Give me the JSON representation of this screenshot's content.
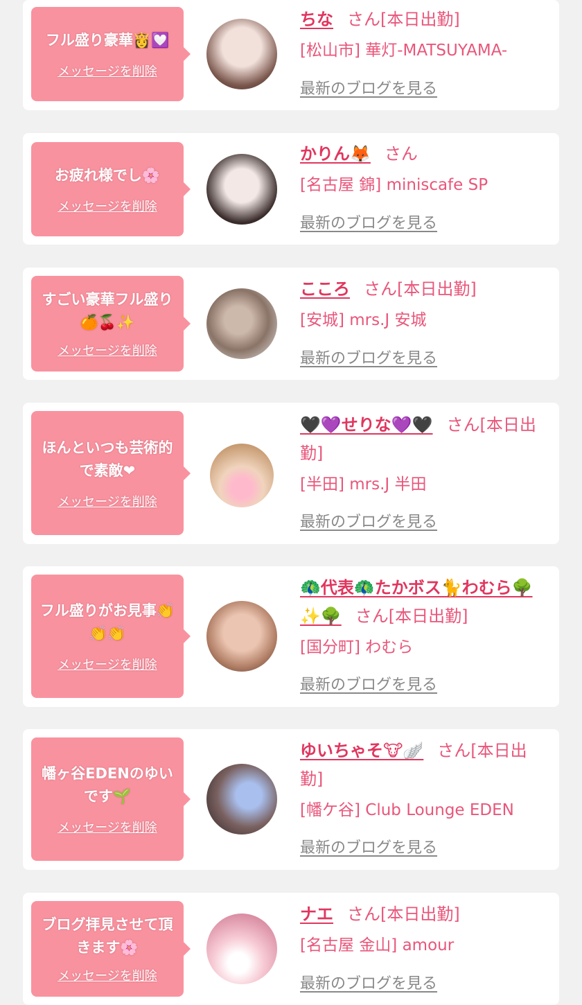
{
  "cards": [
    {
      "message": "フル盛り豪華👸💟",
      "delete_label": "メッセージを削除",
      "name": "ちな",
      "suffix": "さん[本日出勤]",
      "shop": "[松山市] 華灯-MATSUYAMA-",
      "blog_label": "最新のブログを見る",
      "avatar_colors": [
        "#e9d8d2",
        "#6a4a43"
      ]
    },
    {
      "message": "お疲れ様でし🌸",
      "delete_label": "メッセージを削除",
      "name": "かりん🦊",
      "suffix": "さん",
      "shop": "[名古屋 錦] miniscafe SP",
      "blog_label": "最新のブログを見る",
      "avatar_colors": [
        "#efe6e6",
        "#2b2323"
      ]
    },
    {
      "message": "すごい豪華フル盛り🍊🍒✨",
      "delete_label": "メッセージを削除",
      "name": "こころ",
      "suffix": "さん[本日出勤]",
      "shop": "[安城] mrs.J 安城",
      "blog_label": "最新のブログを見る",
      "avatar_colors": [
        "#c9b5a7",
        "#6e5b50"
      ]
    },
    {
      "message": "ほんといつも芸術的で素敵❤",
      "delete_label": "メッセージを削除",
      "name": "🖤💜せりな💜🖤",
      "suffix": "さん[本日出勤]",
      "shop": "[半田] mrs.J 半田",
      "blog_label": "最新のブログを見る",
      "avatar_colors": [
        "#f3d9c2",
        "#ffb3c6"
      ]
    },
    {
      "message": "フル盛りがお見事👏👏👏",
      "delete_label": "メッセージを削除",
      "name": "🦚代表🦚たかボス🐈わむら🌳✨🌳",
      "suffix": "さん[本日出勤]",
      "shop": "[国分町] わむら",
      "blog_label": "最新のブログを見る",
      "avatar_colors": [
        "#e3b7a0",
        "#5c3a30"
      ]
    },
    {
      "message": "幡ヶ谷EDENのゆいです🌱",
      "delete_label": "メッセージを削除",
      "name": "ゆいちゃそ🐮🪽",
      "suffix": "さん[本日出勤]",
      "shop": "[幡ケ谷] Club Lounge EDEN",
      "blog_label": "最新のブログを見る",
      "avatar_colors": [
        "#5b4a4a",
        "#9fb7ea"
      ]
    },
    {
      "message": "ブログ拝見させて頂きます🌸",
      "delete_label": "メッセージを削除",
      "name": "ナエ",
      "suffix": "さん[本日出勤]",
      "shop": "[名古屋 金山] amour",
      "blog_label": "最新のブログを見る",
      "avatar_colors": [
        "#f6c9d3",
        "#ffffff"
      ]
    }
  ]
}
